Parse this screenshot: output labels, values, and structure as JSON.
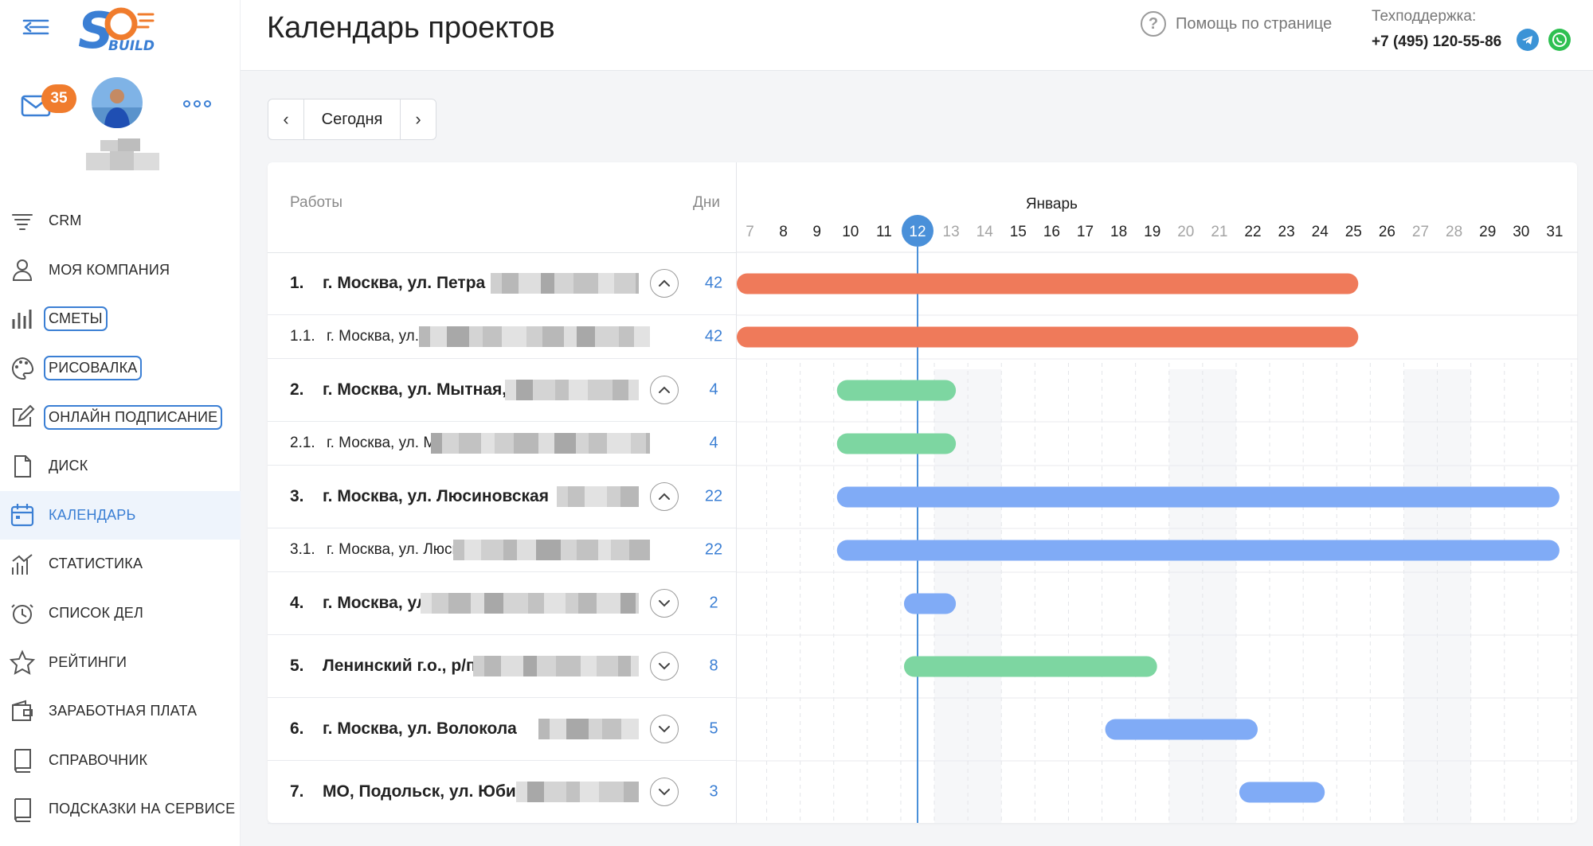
{
  "header": {
    "title": "Календарь проектов",
    "help_label": "Помощь по странице",
    "support_label": "Техподдержка:",
    "support_phone": "+7 (495) 120-55-86"
  },
  "user": {
    "unread_count": "35"
  },
  "sidebar": {
    "items": [
      {
        "label": "CRM",
        "icon": "filter-icon",
        "outlined": false,
        "active": false
      },
      {
        "label": "МОЯ КОМПАНИЯ",
        "icon": "user-icon",
        "outlined": false,
        "active": false
      },
      {
        "label": "СМЕТЫ",
        "icon": "bar-chart-icon",
        "outlined": true,
        "active": false
      },
      {
        "label": "РИСОВАЛКА",
        "icon": "palette-icon",
        "outlined": true,
        "active": false
      },
      {
        "label": "ОНЛАЙН ПОДПИСАНИЕ",
        "icon": "edit-icon",
        "outlined": true,
        "active": false
      },
      {
        "label": "ДИСК",
        "icon": "file-icon",
        "outlined": false,
        "active": false
      },
      {
        "label": "КАЛЕНДАРЬ",
        "icon": "calendar-icon",
        "outlined": false,
        "active": true
      },
      {
        "label": "СТАТИСТИКА",
        "icon": "stats-icon",
        "outlined": false,
        "active": false
      },
      {
        "label": "СПИСОК ДЕЛ",
        "icon": "clock-icon",
        "outlined": false,
        "active": false
      },
      {
        "label": "РЕЙТИНГИ",
        "icon": "star-icon",
        "outlined": false,
        "active": false
      },
      {
        "label": "ЗАРАБОТНАЯ ПЛАТА",
        "icon": "wallet-icon",
        "outlined": false,
        "active": false
      },
      {
        "label": "СПРАВОЧНИК",
        "icon": "book-icon",
        "outlined": false,
        "active": false
      },
      {
        "label": "ПОДСКАЗКИ НА СЕРВИСЕ",
        "icon": "book-icon",
        "outlined": false,
        "active": false
      }
    ]
  },
  "toolbar": {
    "prev_label": "‹",
    "today_label": "Сегодня",
    "next_label": "›"
  },
  "gantt": {
    "col_works": "Работы",
    "col_days": "Дни",
    "month": "Январь",
    "today": 12,
    "days": [
      7,
      8,
      9,
      10,
      11,
      12,
      13,
      14,
      15,
      16,
      17,
      18,
      19,
      20,
      21,
      22,
      23,
      24,
      25,
      26,
      27,
      28,
      29,
      30,
      31
    ],
    "weekend_days": [
      13,
      14,
      20,
      21,
      27,
      28
    ],
    "colors": {
      "orange": "#ef7a5a",
      "green": "#7dd6a1",
      "blue": "#80abf6",
      "today": "#4a90d9"
    },
    "rows": [
      {
        "num": "1.",
        "name": "г. Москва, ул. Петра",
        "days": "42",
        "sub": false,
        "toggle": "up",
        "bar": {
          "start": 7,
          "end": 25.5,
          "color": "orange"
        }
      },
      {
        "num": "1.1.",
        "name": "г. Москва, ул. Петра",
        "days": "42",
        "sub": true,
        "toggle": "",
        "bar": {
          "start": 7,
          "end": 25.5,
          "color": "orange"
        }
      },
      {
        "num": "2.",
        "name": "г. Москва, ул. Мытная,",
        "days": "4",
        "sub": false,
        "toggle": "up",
        "bar": {
          "start": 10,
          "end": 13.5,
          "color": "green"
        }
      },
      {
        "num": "2.1.",
        "name": "г. Москва, ул. Мытная",
        "days": "4",
        "sub": true,
        "toggle": "",
        "bar": {
          "start": 10,
          "end": 13.5,
          "color": "green"
        }
      },
      {
        "num": "3.",
        "name": "г. Москва, ул. Люсиновская",
        "days": "22",
        "sub": false,
        "toggle": "up",
        "bar": {
          "start": 10,
          "end": 31.5,
          "color": "blue"
        }
      },
      {
        "num": "3.1.",
        "name": "г. Москва, ул. Люсиновск",
        "days": "22",
        "sub": true,
        "toggle": "",
        "bar": {
          "start": 10,
          "end": 31.5,
          "color": "blue"
        }
      },
      {
        "num": "4.",
        "name": "г. Москва, ул.",
        "days": "2",
        "sub": false,
        "toggle": "down",
        "bar": {
          "start": 12,
          "end": 13.5,
          "color": "blue"
        }
      },
      {
        "num": "5.",
        "name": "Ленинский г.о., р/п",
        "days": "8",
        "sub": false,
        "toggle": "down",
        "bar": {
          "start": 12,
          "end": 19.5,
          "color": "green"
        }
      },
      {
        "num": "6.",
        "name": "г. Москва, ул. Волокола",
        "days": "5",
        "sub": false,
        "toggle": "down",
        "bar": {
          "start": 18,
          "end": 22.5,
          "color": "blue"
        }
      },
      {
        "num": "7.",
        "name": "МО, Подольск, ул. Юбил",
        "days": "3",
        "sub": false,
        "toggle": "down",
        "bar": {
          "start": 22,
          "end": 24.5,
          "color": "blue"
        }
      }
    ]
  }
}
